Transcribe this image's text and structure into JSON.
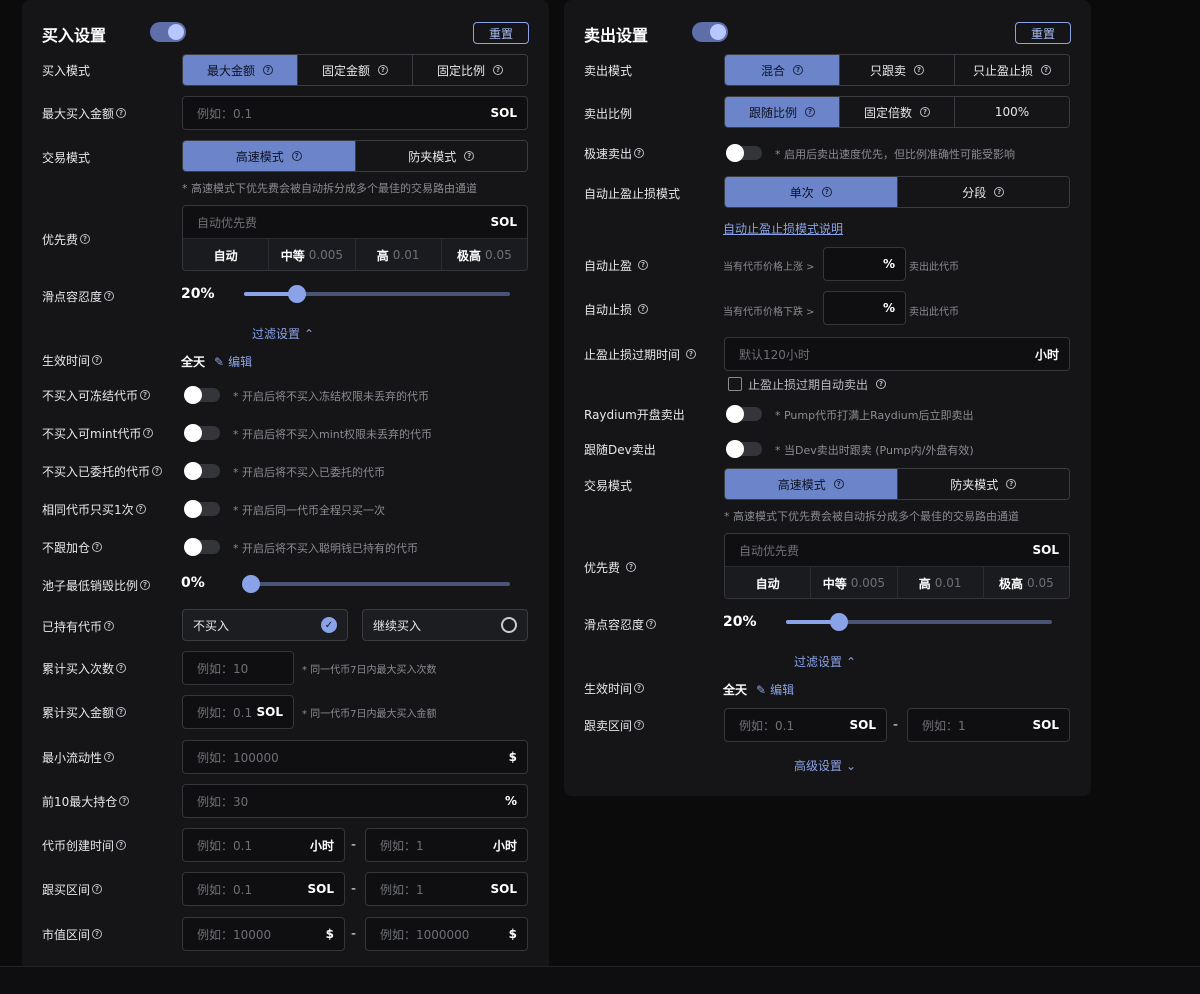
{
  "buy": {
    "title": "买入设置",
    "reset": "重置",
    "mode_label": "买入模式",
    "mode_options": [
      "最大金额",
      "固定金额",
      "固定比例"
    ],
    "max_amount_label": "最大买入金额",
    "max_amount_placeholder": "例如：0.1",
    "sol_unit": "SOL",
    "trade_mode_label": "交易模式",
    "trade_mode_options": [
      "高速模式",
      "防夹模式"
    ],
    "trade_hint": "* 高速模式下优先费会被自动拆分成多个最佳的交易路由通道",
    "priority_label": "优先费",
    "priority_placeholder": "自动优先费",
    "fee_auto": "自动",
    "fee_mid": "中等",
    "fee_mid_val": "0.005",
    "fee_high": "高",
    "fee_high_val": "0.01",
    "fee_max": "极高",
    "fee_max_val": "0.05",
    "slippage_label": "滑点容忍度",
    "slippage_value": "20%",
    "slippage_fraction": 0.2,
    "filter": "过滤设置",
    "effective_label": "生效时间",
    "effective_value": "全天",
    "edit": "编辑",
    "toggles": [
      {
        "label": "不买入可冻结代币",
        "hint": "* 开启后将不买入冻结权限未丢弃的代币"
      },
      {
        "label": "不买入可mint代币",
        "hint": "* 开启后将不买入mint权限未丢弃的代币"
      },
      {
        "label": "不买入已委托的代币",
        "hint": "* 开启后将不买入已委托的代币"
      },
      {
        "label": "相同代币只买1次",
        "hint": "* 开启后同一代币全程只买一次"
      },
      {
        "label": "不跟加仓",
        "hint": "* 开启后将不买入聪明钱已持有的代币"
      }
    ],
    "burn_label": "池子最低销毁比例",
    "burn_value": "0%",
    "burn_fraction": 0,
    "held_label": "已持有代币",
    "held_opt1": "不买入",
    "held_opt2": "继续买入",
    "cum_count_label": "累计买入次数",
    "cum_count_placeholder": "例如：10",
    "cum_count_hint": "* 同一代币7日内最大买入次数",
    "cum_amount_label": "累计买入金额",
    "cum_amount_placeholder": "例如：0.1",
    "cum_amount_hint": "* 同一代币7日内最大买入金额",
    "liquidity_label": "最小流动性",
    "liquidity_placeholder": "例如：100000",
    "dollar": "$",
    "top10_label": "前10最大持仓",
    "top10_placeholder": "例如：30",
    "percent": "%",
    "created_label": "代币创建时间",
    "ph_01": "例如：0.1",
    "ph_1": "例如：1",
    "hour_unit": "小时",
    "dash": "-",
    "follow_range_label": "跟买区间",
    "mcap_label": "市值区间",
    "mcap_min_placeholder": "例如：10000",
    "mcap_max_placeholder": "例如：1000000"
  },
  "sell": {
    "title": "卖出设置",
    "reset": "重置",
    "mode_label": "卖出模式",
    "mode_options": [
      "混合",
      "只跟卖",
      "只止盈止损"
    ],
    "ratio_label": "卖出比例",
    "ratio_options": [
      "跟随比例",
      "固定倍数",
      "100%"
    ],
    "fast_label": "极速卖出",
    "fast_hint": "* 启用后卖出速度优先，但比例准确性可能受影响",
    "auto_tp_mode_label": "自动止盈止损模式",
    "auto_tp_mode_options": [
      "单次",
      "分段"
    ],
    "auto_tp_link": "自动止盈止损模式说明",
    "tp_label": "自动止盈",
    "tp_pre": "当有代币价格上涨 >",
    "tp_post": "卖出此代币",
    "sl_label": "自动止损",
    "sl_pre": "当有代币价格下跌 >",
    "sl_post": "卖出此代币",
    "percent": "%",
    "expire_label": "止盈止损过期时间",
    "expire_placeholder": "默认120小时",
    "hour_unit": "小时",
    "expire_check": "止盈止损过期自动卖出",
    "raydium_label": "Raydium开盘卖出",
    "raydium_hint": "* Pump代币打满上Raydium后立即卖出",
    "dev_label": "跟随Dev卖出",
    "dev_hint": "* 当Dev卖出时跟卖 (Pump内/外盘有效)",
    "trade_mode_label": "交易模式",
    "trade_mode_options": [
      "高速模式",
      "防夹模式"
    ],
    "trade_hint": "* 高速模式下优先费会被自动拆分成多个最佳的交易路由通道",
    "priority_label": "优先费",
    "priority_placeholder": "自动优先费",
    "sol_unit": "SOL",
    "fee_auto": "自动",
    "fee_mid": "中等",
    "fee_mid_val": "0.005",
    "fee_high": "高",
    "fee_high_val": "0.01",
    "fee_max": "极高",
    "fee_max_val": "0.05",
    "slippage_label": "滑点容忍度",
    "slippage_value": "20%",
    "slippage_fraction": 0.2,
    "filter": "过滤设置",
    "effective_label": "生效时间",
    "effective_value": "全天",
    "edit": "编辑",
    "range_label": "跟卖区间",
    "ph_01": "例如：0.1",
    "ph_1": "例如：1",
    "dash": "-",
    "advanced": "高级设置"
  }
}
